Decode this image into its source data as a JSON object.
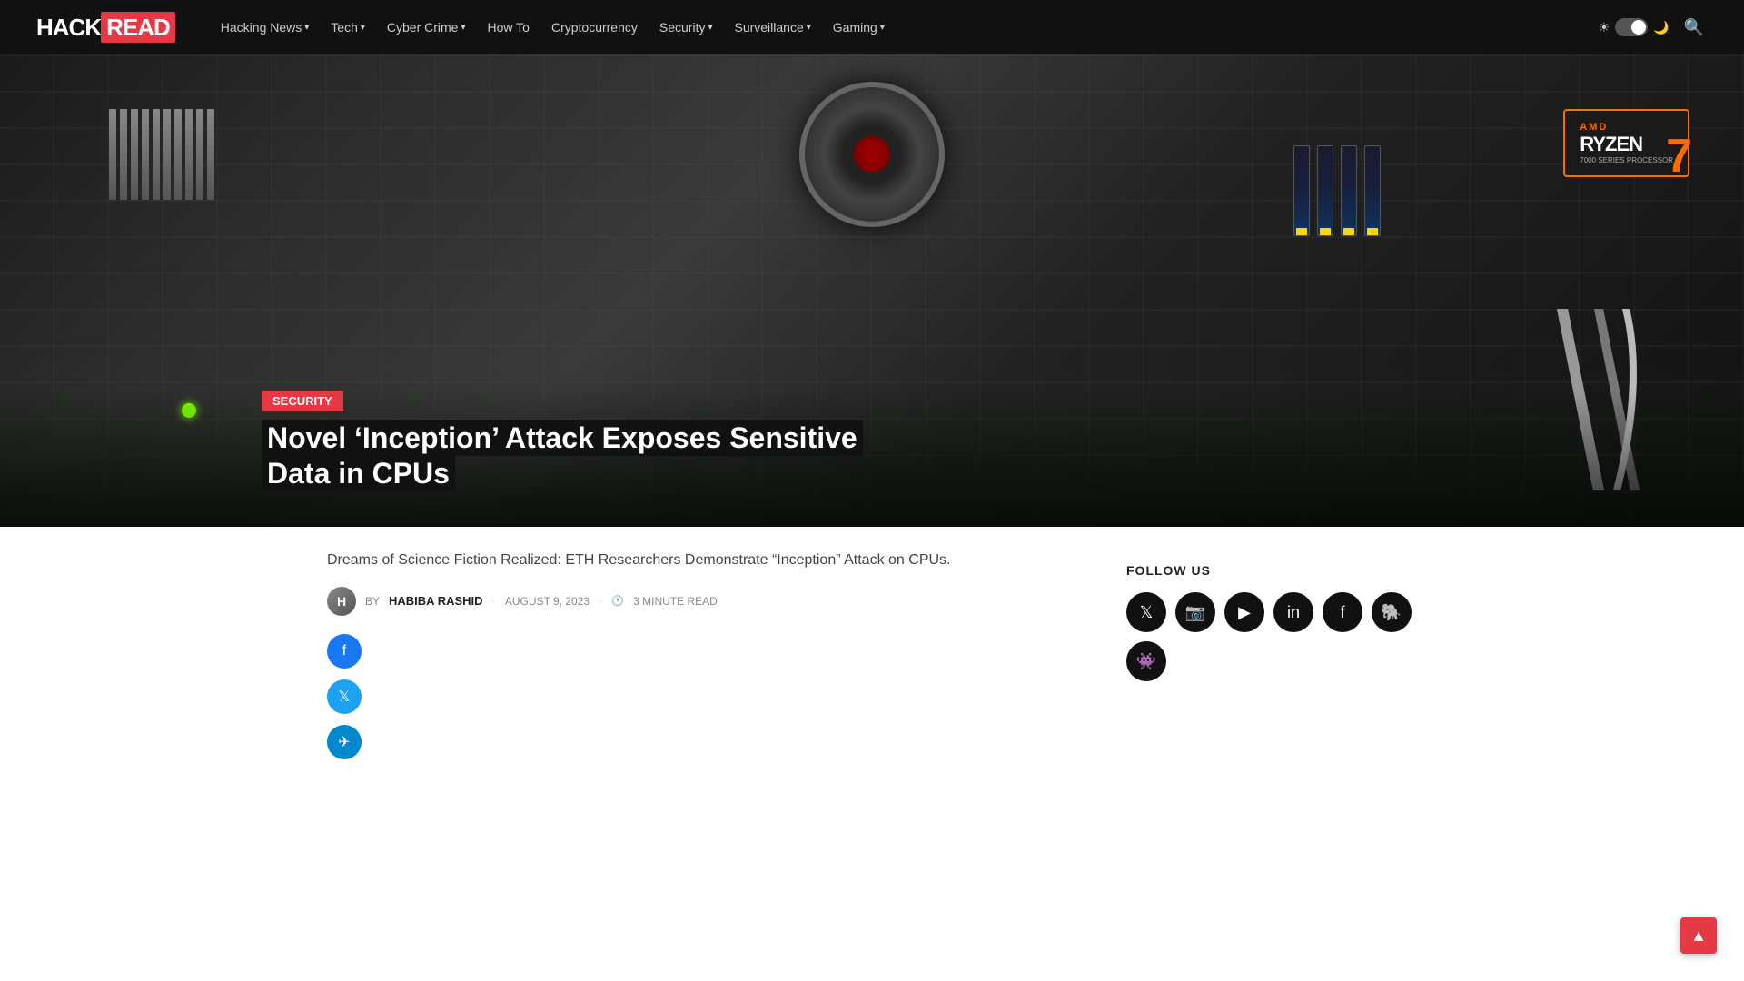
{
  "site": {
    "logo_hack": "HACK",
    "logo_read": "READ",
    "title": "HackRead"
  },
  "nav": {
    "links": [
      {
        "label": "Hacking News",
        "has_dropdown": true
      },
      {
        "label": "Tech",
        "has_dropdown": true
      },
      {
        "label": "Cyber Crime",
        "has_dropdown": true
      },
      {
        "label": "How To",
        "has_dropdown": false
      },
      {
        "label": "Cryptocurrency",
        "has_dropdown": false
      },
      {
        "label": "Security",
        "has_dropdown": true
      },
      {
        "label": "Surveillance",
        "has_dropdown": true
      },
      {
        "label": "Gaming",
        "has_dropdown": true
      }
    ]
  },
  "hero": {
    "category": "Security",
    "title_line1": "Novel ‘Inception’ Attack Exposes Sensitive",
    "title_line2": "Data in CPUs"
  },
  "article": {
    "subtitle": "Dreams of Science Fiction Realized: ETH Researchers Demonstrate “Inception” Attack on CPUs.",
    "author_by": "BY",
    "author_name": "HABIBA RASHID",
    "date": "AUGUST 9, 2023",
    "read_time": "3 MINUTE READ"
  },
  "sidebar": {
    "follow_us_title": "FOLLOW US"
  },
  "social": {
    "platforms": [
      {
        "name": "twitter",
        "icon": "𝕏"
      },
      {
        "name": "instagram",
        "icon": "📷"
      },
      {
        "name": "youtube",
        "icon": "▶"
      },
      {
        "name": "linkedin",
        "icon": "in"
      },
      {
        "name": "facebook",
        "icon": "f"
      },
      {
        "name": "mastodon",
        "icon": "🐘"
      },
      {
        "name": "reddit",
        "icon": "👾"
      }
    ]
  },
  "amd_box": {
    "logo": "AMD",
    "brand": "RYZEN",
    "sub": "7000 SERIES PROCESSOR",
    "badge": "7"
  }
}
